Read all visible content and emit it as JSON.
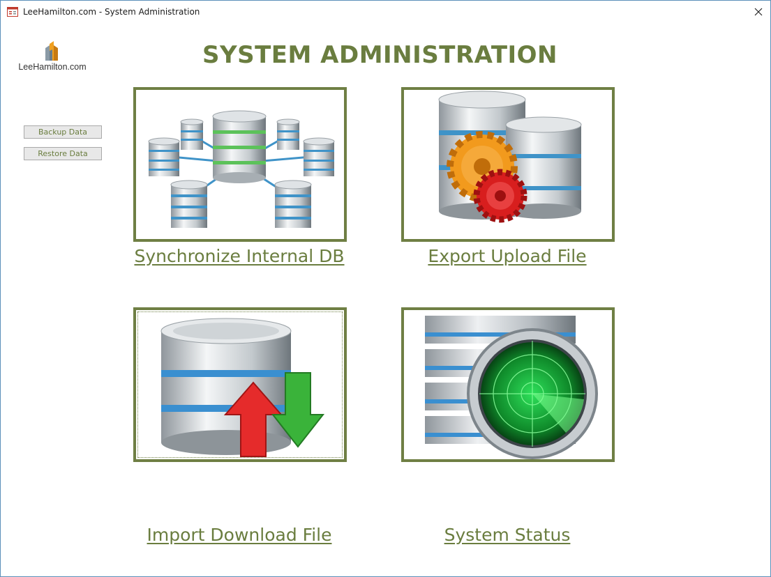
{
  "window": {
    "title": "LeeHamilton.com - System Administration"
  },
  "logo": {
    "text": "LeeHamilton.com"
  },
  "page": {
    "title": "SYSTEM ADMINISTRATION"
  },
  "sidebar": {
    "buttons": [
      {
        "label": "Backup Data"
      },
      {
        "label": "Restore Data"
      }
    ]
  },
  "tiles": [
    {
      "label": "Synchronize Internal DB",
      "icon": "database-network-icon"
    },
    {
      "label": "Export Upload File",
      "icon": "database-gears-icon"
    },
    {
      "label": "Import Download File",
      "icon": "database-transfer-icon"
    },
    {
      "label": "System Status",
      "icon": "database-radar-icon"
    }
  ],
  "colors": {
    "accent": "#6a7d3f",
    "tile_border": "#6f7f44",
    "window_border": "#5b8fb9"
  }
}
